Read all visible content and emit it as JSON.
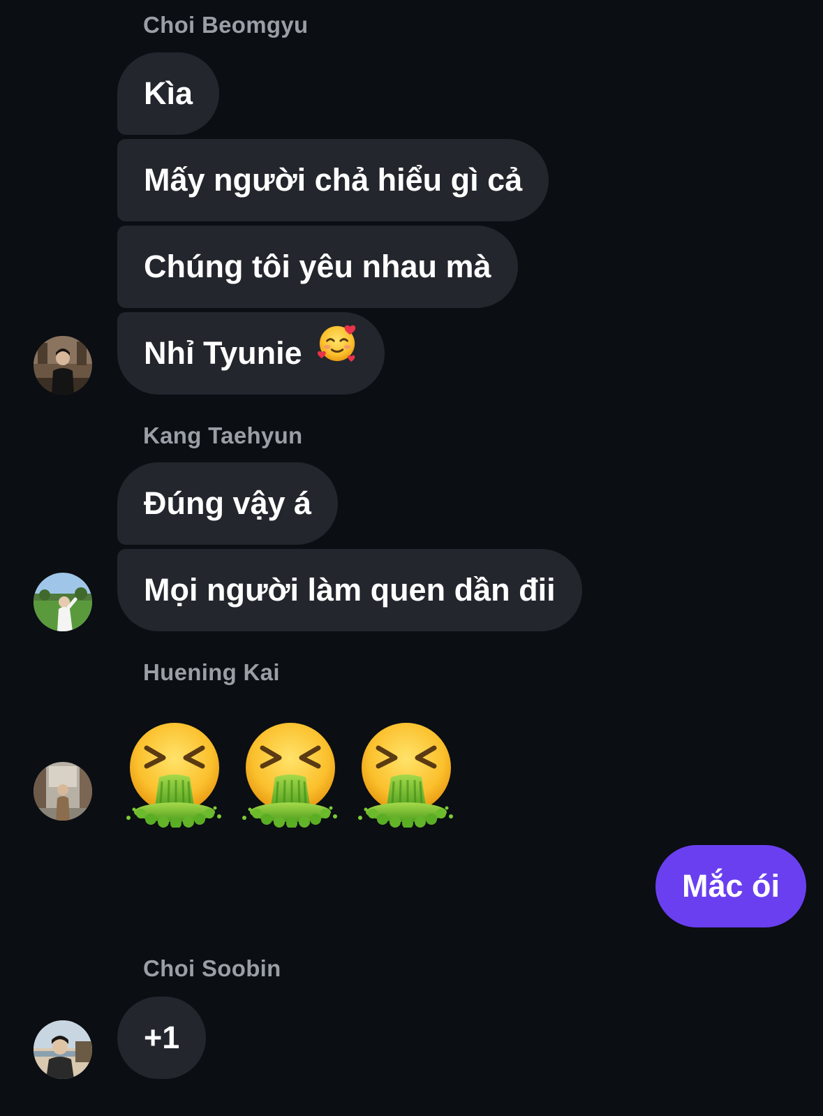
{
  "groups": [
    {
      "sender": "Choi Beomgyu",
      "avatar_icon": "beomgyu-avatar",
      "messages": [
        "Kìa",
        "Mấy người chả hiểu gì cả",
        "Chúng tôi yêu nhau mà",
        "Nhỉ Tyunie"
      ],
      "last_message_emoji": "smiling-face-with-hearts-emoji"
    },
    {
      "sender": "Kang Taehyun",
      "avatar_icon": "taehyun-avatar",
      "messages": [
        "Đúng vậy á",
        "Mọi người làm quen dần đii"
      ]
    },
    {
      "sender": "Huening Kai",
      "avatar_icon": "kai-avatar",
      "emoji_message": [
        "face-vomiting-emoji",
        "face-vomiting-emoji",
        "face-vomiting-emoji"
      ]
    },
    {
      "sender": "Choi Soobin",
      "avatar_icon": "soobin-avatar",
      "messages": [
        "+1"
      ]
    }
  ],
  "outgoing": {
    "text": "Mắc ói"
  },
  "colors": {
    "background": "#0b0e13",
    "incoming_bubble": "#23262c",
    "outgoing_bubble": "#6a3ff0",
    "sender_name": "#9a9fa6"
  }
}
